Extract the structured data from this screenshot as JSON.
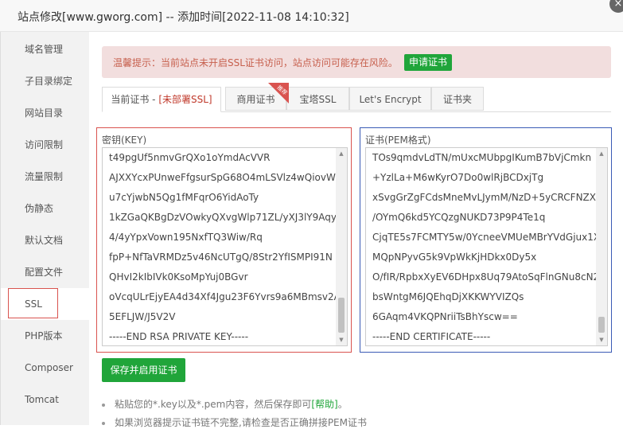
{
  "window": {
    "title": "站点修改[www.gworg.com] -- 添加时间[2022-11-08 14:10:32]",
    "close_symbol": "×"
  },
  "sidebar": {
    "items": [
      {
        "label": "域名管理"
      },
      {
        "label": "子目录绑定"
      },
      {
        "label": "网站目录"
      },
      {
        "label": "访问限制"
      },
      {
        "label": "流量限制"
      },
      {
        "label": "伪静态"
      },
      {
        "label": "默认文档"
      },
      {
        "label": "配置文件"
      },
      {
        "label": "SSL",
        "active": true
      },
      {
        "label": "PHP版本"
      },
      {
        "label": "Composer"
      },
      {
        "label": "Tomcat"
      }
    ]
  },
  "alert": {
    "text": "温馨提示：当前站点未开启SSL证书访问，站点访问可能存在风险。",
    "button": "申请证书"
  },
  "tabs": {
    "current": "当前证书 - ",
    "current_status": "[未部署SSL]",
    "commercial": "商用证书",
    "commercial_badge": "推荐",
    "baota": "宝塔SSL",
    "letsencrypt": "Let's Encrypt",
    "folder": "证书夹"
  },
  "key_panel": {
    "label": "密钥(KEY)",
    "lines": [
      "t49pgUf5nmvGrQXo1oYmdAcVVR",
      "AJXXYcxPUnweFfgsurSpG68O4mLSVlz4wQiovW",
      "u7cYjwbN5Qg1fMFqrO6YidAoTy",
      "1kZGaQKBgDzVOwkyQXvgWlp71ZL/yXJ3lY9Aqy",
      "4/4yYpxVown195NxfTQ3Wiw/Rq",
      "fpP+NfTaVRMDz5v46NcUTgQ/8Str2YfISMPI91N",
      "QHvI2kIbIVk0KsoMpYuj0BGvr",
      "oVcqULrEjyEA4d34Xf4Jgu23F6Yvrs9a6MBmsv2A",
      "5EFLJW/J5V2V",
      "-----END RSA PRIVATE KEY-----"
    ]
  },
  "cert_panel": {
    "label": "证书(PEM格式)",
    "lines": [
      "TOs9qmdvLdTN/mUxcMUbpgIKumB7bVjCmkn",
      "+YzlLa+M6wKyrO7Do0wlRjBCDxjTg",
      "xSvgGrZgFCdsMneMvLJymM/NzD+5yCRCFNZX",
      "/OYmQ6kd5YCQzgNUKD73P9P4Te1q",
      "CjqTE5s7FCMTY5w/0YcneeVMUeMBrYVdGjux1X",
      "MQpNPyvG5k9VpWkKjHDkx0Dy5x",
      "O/fIR/RpbxXyEV6DHpx8Uq79AtoSqFlnGNu8cN2",
      "bsWntgM6JQEhqDjXKKWYVIZQs",
      "6GAqm4VKQPNriiTsBhYscw==",
      "-----END CERTIFICATE-----"
    ]
  },
  "actions": {
    "save": "保存并启用证书"
  },
  "notes": {
    "note1_prefix": "粘贴您的*.key以及*.pem内容，然后保存即可",
    "note1_help": "[帮助]",
    "note1_suffix": "。",
    "note2": "如果浏览器提示证书链不完整,请检查是否正确拼接PEM证书"
  },
  "colors": {
    "accent_green": "#20a53a",
    "alert_bg": "#f2dede",
    "alert_text": "#c7604e",
    "key_border": "#d9534f",
    "cert_border": "#3b5bb5"
  }
}
